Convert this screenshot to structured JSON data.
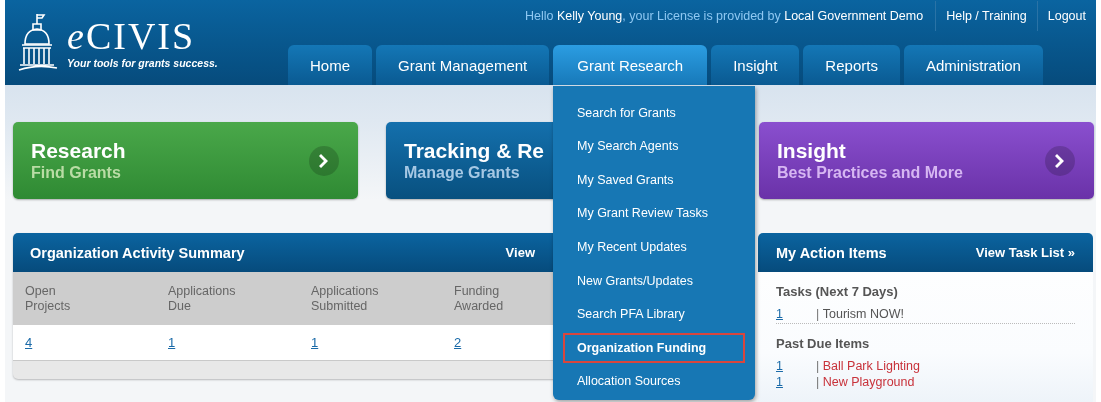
{
  "header": {
    "logo": {
      "prefix": "e",
      "name": "CIVIS",
      "tagline": "Your tools for grants success."
    },
    "greeting": [
      {
        "kind": "plain",
        "text": "Hello "
      },
      {
        "kind": "name",
        "text": "Kelly Young"
      },
      {
        "kind": "plain",
        "text": ", your License is provided by "
      },
      {
        "kind": "name",
        "text": "Local Government Demo"
      }
    ],
    "links": [
      "Help / Training",
      "Logout"
    ]
  },
  "tabs": [
    {
      "label": "Home",
      "selected": false
    },
    {
      "label": "Grant Management",
      "selected": false
    },
    {
      "label": "Grant Research",
      "selected": true
    },
    {
      "label": "Insight",
      "selected": false
    },
    {
      "label": "Reports",
      "selected": false
    },
    {
      "label": "Administration",
      "selected": false
    }
  ],
  "menu": {
    "items": [
      {
        "label": "Search for Grants",
        "selected": false
      },
      {
        "label": "My Search Agents",
        "selected": false
      },
      {
        "label": "My Saved Grants",
        "selected": false
      },
      {
        "label": "My Grant Review Tasks",
        "selected": false
      },
      {
        "label": "My Recent Updates",
        "selected": false
      },
      {
        "label": "New Grants/Updates",
        "selected": false
      },
      {
        "label": "Search PFA Library",
        "selected": false
      },
      {
        "label": "Organization Funding",
        "selected": true
      },
      {
        "label": "Allocation Sources",
        "selected": false
      }
    ]
  },
  "cards": [
    {
      "kind": "research",
      "title": "Research",
      "subtitle": "Find Grants",
      "arrow": true
    },
    {
      "kind": "tracking",
      "title": "Tracking & Re",
      "subtitle": "Manage Grants"
    },
    {
      "kind": "insight",
      "title": "Insight",
      "subtitle": "Best Practices and More",
      "arrow": true
    }
  ],
  "activity_summary": {
    "title": "Organization Activity Summary",
    "link": "View",
    "columns": [
      "Open Projects",
      "Applications Due",
      "Applications Submitted",
      "Funding Awarded"
    ],
    "values": [
      "4",
      "1",
      "1",
      "2"
    ]
  },
  "action_items": {
    "title": "My Action Items",
    "link": "View Task List »",
    "sections": [
      {
        "kind": "upcoming",
        "title": "Tasks (Next 7 Days)",
        "items": [
          {
            "count": "1",
            "separator": "|",
            "name": "Tourism NOW!"
          }
        ]
      },
      {
        "kind": "past_due",
        "title": "Past Due Items",
        "items": [
          {
            "count": "1",
            "separator": "|",
            "name": "Ball Park Lighting"
          },
          {
            "count": "1",
            "separator": "|",
            "name": "New Playground"
          }
        ]
      }
    ]
  }
}
